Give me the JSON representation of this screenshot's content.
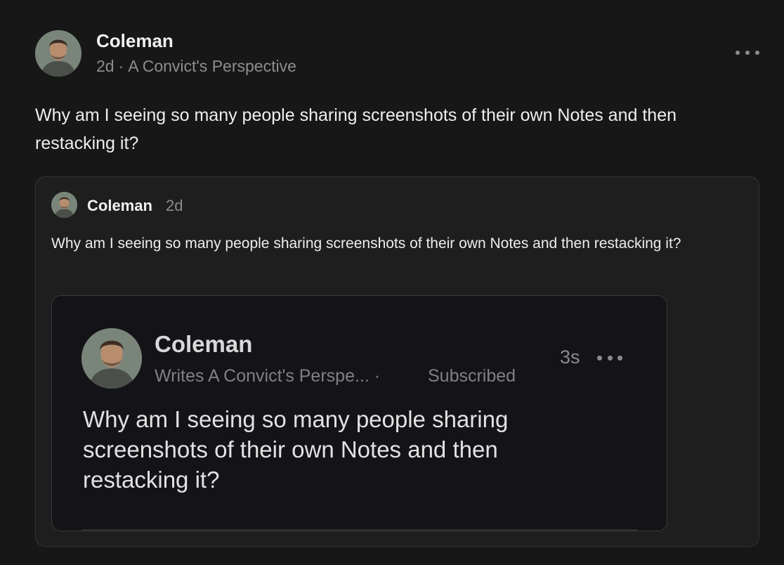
{
  "post": {
    "author": "Coleman",
    "time": "2d",
    "separator": "·",
    "publication": "A Convict's Perspective",
    "text": "Why am I seeing so many people sharing screenshots of their own Notes and then restacking it?",
    "more_icon": "more-horizontal-icon",
    "avatar_icon": "author-avatar"
  },
  "quoted": {
    "author": "Coleman",
    "time": "2d",
    "text": "Why am I seeing so many people sharing screenshots of their own Notes and then restacking it?"
  },
  "screenshot": {
    "author": "Coleman",
    "writes": "Writes A Convict's Perspe...",
    "separator": "·",
    "status": "Subscribed",
    "time": "3s",
    "text": "Why am I seeing so many people sharing screenshots of their own Notes and then restacking it?"
  },
  "colors": {
    "background": "#171717",
    "card": "#1e1e1e",
    "screenshot_bg": "#141418",
    "muted_text": "#8d8d8d"
  }
}
